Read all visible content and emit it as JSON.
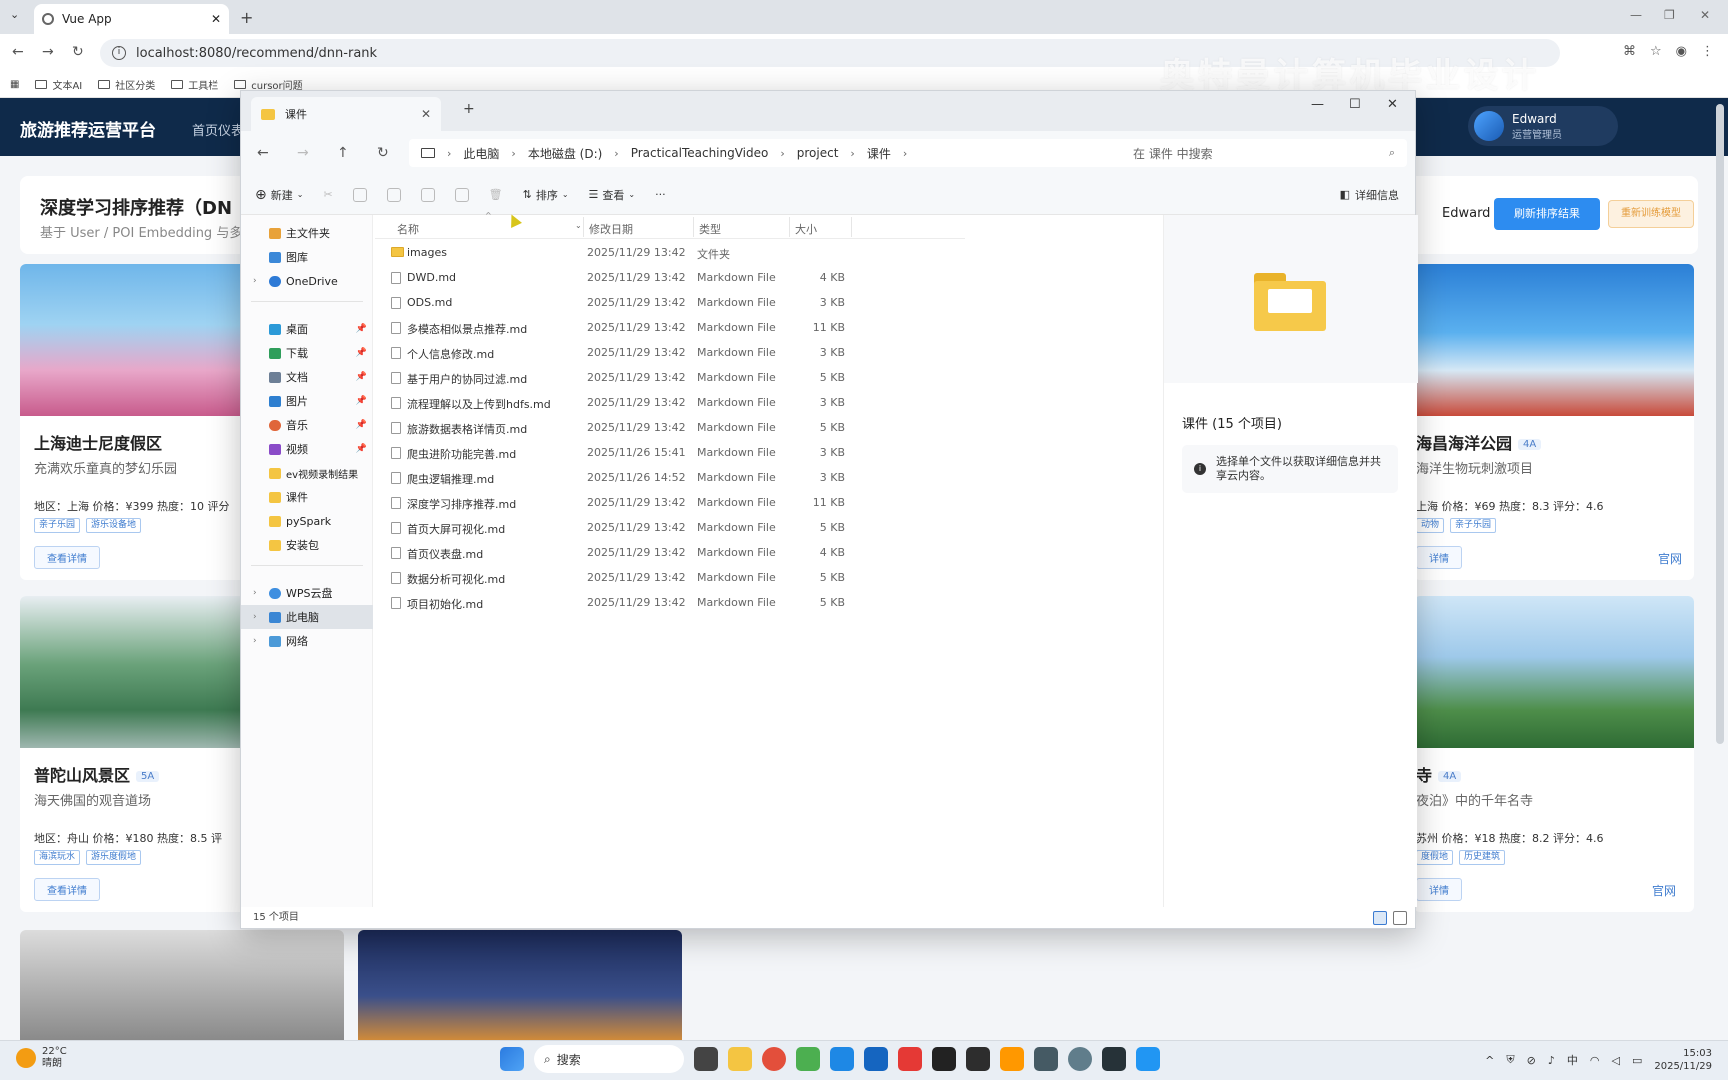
{
  "browser": {
    "tab_title": "Vue App",
    "url": "localhost:8080/recommend/dnn-rank",
    "bookmarks": [
      "文本AI",
      "社区分类",
      "工具栏",
      "cursor问题"
    ],
    "watermark": "奥特曼计算机毕业设计"
  },
  "app": {
    "title": "旅游推荐运营平台",
    "nav_item": "首页仪表",
    "user_name": "Edward",
    "user_role": "运营管理员",
    "panel_title": "深度学习排序推荐（DN",
    "panel_subtitle": "基于 User / POI Embedding 与多",
    "panel_user": "Edward",
    "refresh_button": "刷新排序结果",
    "retrain_button": "重新训练模型"
  },
  "cards": [
    {
      "name": "上海迪士尼度假区",
      "desc": "充满欢乐童真的梦幻乐园",
      "meta": "地区：上海    价格：¥399    热度：10    评分",
      "tags": [
        "亲子乐园",
        "游乐设备地"
      ],
      "detail": "查看详情"
    },
    {
      "name": "海昌海洋公园",
      "badge": "4A",
      "desc": "海洋生物玩刺激项目",
      "meta": "上海    价格：¥69    热度：8.3    评分：4.6",
      "tags": [
        "动物",
        "亲子乐园"
      ],
      "detail": "详情",
      "official": "官网"
    },
    {
      "name": "普陀山风景区",
      "badge": "5A",
      "desc": "海天佛国的观音道场",
      "meta": "地区：舟山    价格：¥180    热度：8.5    评",
      "tags": [
        "海滨玩水",
        "游乐度假地"
      ],
      "detail": "查看详情"
    },
    {
      "name": "寺",
      "badge": "4A",
      "desc": "夜泊》中的千年名寺",
      "meta": "苏州    价格：¥18    热度：8.2    评分：4.6",
      "tags": [
        "度假地",
        "历史建筑"
      ],
      "detail": "详情",
      "official": "官网"
    }
  ],
  "explorer": {
    "tab_title": "课件",
    "breadcrumb": [
      "此电脑",
      "本地磁盘 (D:)",
      "PracticalTeachingVideo",
      "project",
      "课件"
    ],
    "search_placeholder": "在 课件 中搜索",
    "toolbar": {
      "new": "新建",
      "sort": "排序",
      "view": "查看",
      "more": "···",
      "details": "详细信息"
    },
    "columns": {
      "name": "名称",
      "date": "修改日期",
      "type": "类型",
      "size": "大小"
    },
    "sidebar": [
      {
        "label": "主文件夹",
        "icon": "home-icon"
      },
      {
        "label": "图库",
        "icon": "gallery-icon"
      },
      {
        "label": "OneDrive",
        "icon": "cloud-icon"
      },
      {
        "label": "桌面",
        "icon": "desktop-icon"
      },
      {
        "label": "下载",
        "icon": "download-icon"
      },
      {
        "label": "文档",
        "icon": "document-icon"
      },
      {
        "label": "图片",
        "icon": "picture-icon"
      },
      {
        "label": "音乐",
        "icon": "music-icon"
      },
      {
        "label": "视频",
        "icon": "video-icon"
      },
      {
        "label": "ev视频录制结果",
        "icon": "folder-icon"
      },
      {
        "label": "课件",
        "icon": "folder-icon"
      },
      {
        "label": "pySpark",
        "icon": "folder-icon"
      },
      {
        "label": "安装包",
        "icon": "folder-icon"
      },
      {
        "label": "WPS云盘",
        "icon": "cloud-icon"
      },
      {
        "label": "此电脑",
        "icon": "pc-icon"
      },
      {
        "label": "网络",
        "icon": "network-icon"
      }
    ],
    "files": [
      {
        "name": "images",
        "date": "2025/11/29 13:42",
        "type": "文件夹",
        "size": ""
      },
      {
        "name": "DWD.md",
        "date": "2025/11/29 13:42",
        "type": "Markdown File",
        "size": "4 KB"
      },
      {
        "name": "ODS.md",
        "date": "2025/11/29 13:42",
        "type": "Markdown File",
        "size": "3 KB"
      },
      {
        "name": "多模态相似景点推荐.md",
        "date": "2025/11/29 13:42",
        "type": "Markdown File",
        "size": "11 KB"
      },
      {
        "name": "个人信息修改.md",
        "date": "2025/11/29 13:42",
        "type": "Markdown File",
        "size": "3 KB"
      },
      {
        "name": "基于用户的协同过滤.md",
        "date": "2025/11/29 13:42",
        "type": "Markdown File",
        "size": "5 KB"
      },
      {
        "name": "流程理解以及上传到hdfs.md",
        "date": "2025/11/29 13:42",
        "type": "Markdown File",
        "size": "3 KB"
      },
      {
        "name": "旅游数据表格详情页.md",
        "date": "2025/11/29 13:42",
        "type": "Markdown File",
        "size": "5 KB"
      },
      {
        "name": "爬虫进阶功能完善.md",
        "date": "2025/11/26 15:41",
        "type": "Markdown File",
        "size": "3 KB"
      },
      {
        "name": "爬虫逻辑推理.md",
        "date": "2025/11/26 14:52",
        "type": "Markdown File",
        "size": "3 KB"
      },
      {
        "name": "深度学习排序推荐.md",
        "date": "2025/11/29 13:42",
        "type": "Markdown File",
        "size": "11 KB"
      },
      {
        "name": "首页大屏可视化.md",
        "date": "2025/11/29 13:42",
        "type": "Markdown File",
        "size": "5 KB"
      },
      {
        "name": "首页仪表盘.md",
        "date": "2025/11/29 13:42",
        "type": "Markdown File",
        "size": "4 KB"
      },
      {
        "name": "数据分析可视化.md",
        "date": "2025/11/29 13:42",
        "type": "Markdown File",
        "size": "5 KB"
      },
      {
        "name": "项目初始化.md",
        "date": "2025/11/29 13:42",
        "type": "Markdown File",
        "size": "5 KB"
      }
    ],
    "preview_title": "课件 (15 个项目)",
    "preview_hint": "选择单个文件以获取详细信息并共享云内容。",
    "status": "15 个项目"
  },
  "taskbar": {
    "temp": "22°C",
    "weather": "晴朗",
    "search": "搜索",
    "ime": "中",
    "time": "15:03",
    "date": "2025/11/29"
  }
}
